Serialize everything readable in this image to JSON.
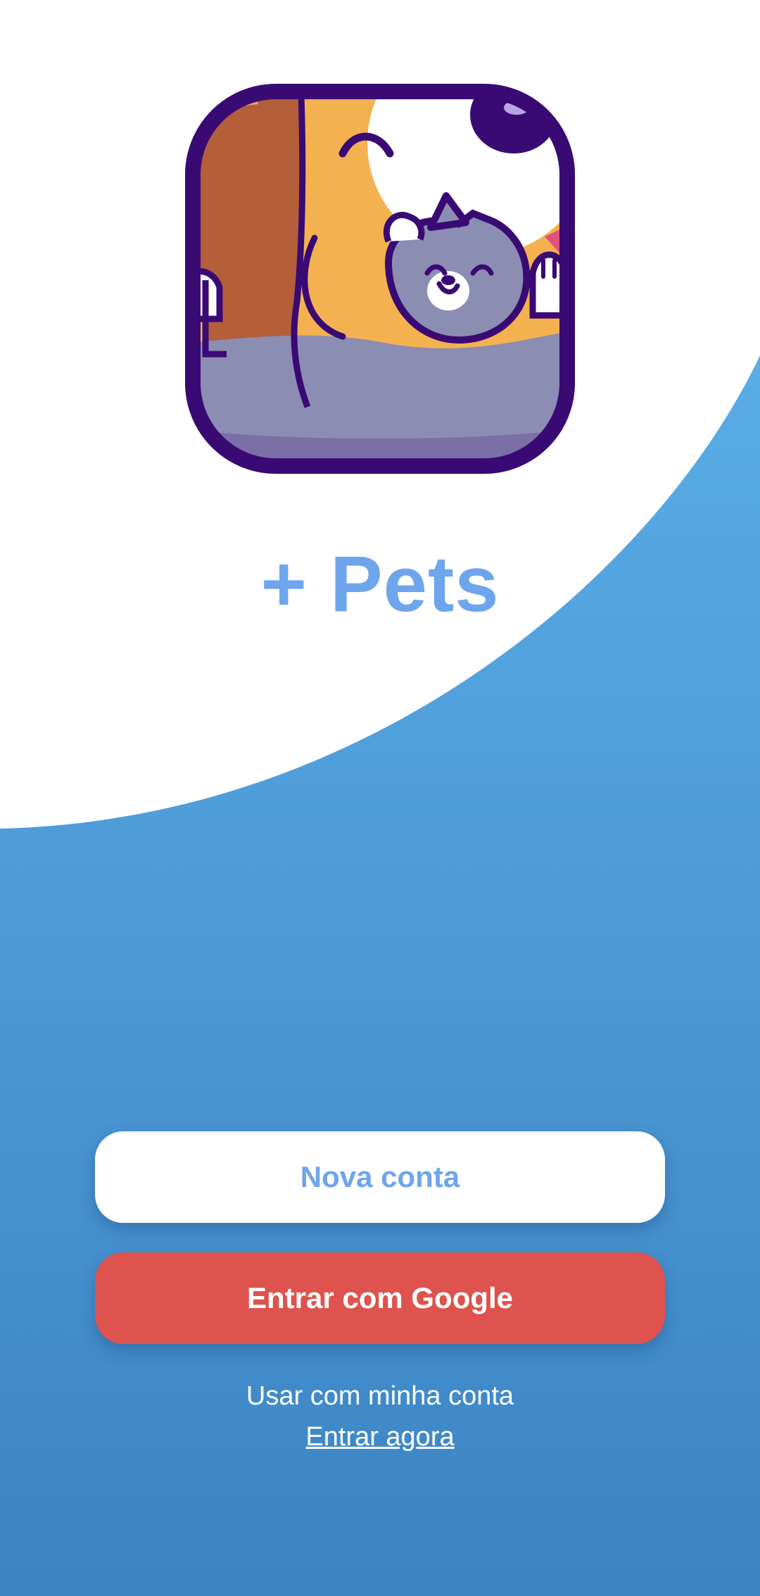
{
  "app": {
    "title": "+ Pets",
    "logo_icon": "dog-and-cat-logo-icon"
  },
  "actions": {
    "new_account_label": "Nova conta",
    "google_label": "Entrar com Google",
    "own_account_text": "Usar com minha conta",
    "enter_now_label": "Entrar agora"
  },
  "colors": {
    "title": "#6ea5ec",
    "background_top": "#62b8ef",
    "background_bottom": "#3c84c4",
    "new_account_text": "#6ea5ec",
    "google_button": "#de534d",
    "on_blue_text": "#ffffff",
    "logo_outline": "#3a0a74"
  }
}
